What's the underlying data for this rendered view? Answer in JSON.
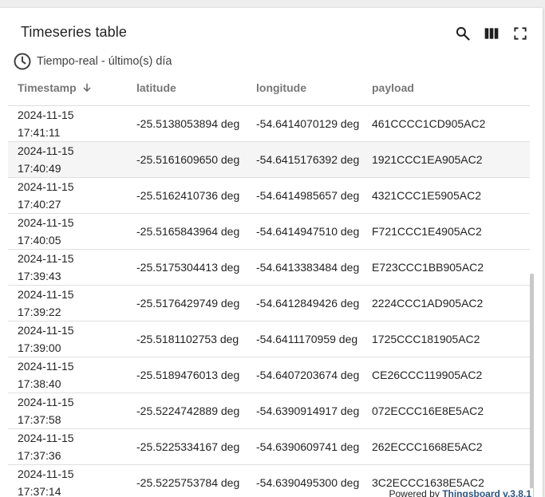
{
  "widget": {
    "title": "Timeseries table",
    "timewindow": "Tiempo-real - último(s) día"
  },
  "toolbar": {
    "icons": [
      "search-icon",
      "columns-icon",
      "fullscreen-icon"
    ]
  },
  "table": {
    "columns": {
      "timestamp": "Timestamp",
      "latitude": "latitude",
      "longitude": "longitude",
      "payload": "payload"
    },
    "sort": "timestamp-descending",
    "rows": [
      {
        "date": "2024-11-15",
        "time": "17:41:11",
        "latitude": "-25.5138053894 deg",
        "longitude": "-54.6414070129 deg",
        "payload": "461CCCC1CD905AC2"
      },
      {
        "date": "2024-11-15",
        "time": "17:40:49",
        "latitude": "-25.5161609650 deg",
        "longitude": "-54.6415176392 deg",
        "payload": "1921CCC1EA905AC2"
      },
      {
        "date": "2024-11-15",
        "time": "17:40:27",
        "latitude": "-25.5162410736 deg",
        "longitude": "-54.6414985657 deg",
        "payload": "4321CCC1E5905AC2"
      },
      {
        "date": "2024-11-15",
        "time": "17:40:05",
        "latitude": "-25.5165843964 deg",
        "longitude": "-54.6414947510 deg",
        "payload": "F721CCC1E4905AC2"
      },
      {
        "date": "2024-11-15",
        "time": "17:39:43",
        "latitude": "-25.5175304413 deg",
        "longitude": "-54.6413383484 deg",
        "payload": "E723CCC1BB905AC2"
      },
      {
        "date": "2024-11-15",
        "time": "17:39:22",
        "latitude": "-25.5176429749 deg",
        "longitude": "-54.6412849426 deg",
        "payload": "2224CCC1AD905AC2"
      },
      {
        "date": "2024-11-15",
        "time": "17:39:00",
        "latitude": "-25.5181102753 deg",
        "longitude": "-54.6411170959 deg",
        "payload": "1725CCC181905AC2"
      },
      {
        "date": "2024-11-15",
        "time": "17:38:40",
        "latitude": "-25.5189476013 deg",
        "longitude": "-54.6407203674 deg",
        "payload": "CE26CCC119905AC2"
      },
      {
        "date": "2024-11-15",
        "time": "17:37:58",
        "latitude": "-25.5224742889 deg",
        "longitude": "-54.6390914917 deg",
        "payload": "072ECCC16E8E5AC2"
      },
      {
        "date": "2024-11-15",
        "time": "17:37:36",
        "latitude": "-25.5225334167 deg",
        "longitude": "-54.6390609741 deg",
        "payload": "262ECCC1668E5AC2"
      },
      {
        "date": "2024-11-15",
        "time": "17:37:14",
        "latitude": "-25.5225753784 deg",
        "longitude": "-54.6390495300 deg",
        "payload": "3C2ECCC1638E5AC2"
      }
    ]
  },
  "footer": {
    "powered_by": "Powered by",
    "link_text": "Thingsboard v.3.8.1"
  },
  "colors": {
    "link": "#305680",
    "highlight_row": "#f5f5f5"
  }
}
